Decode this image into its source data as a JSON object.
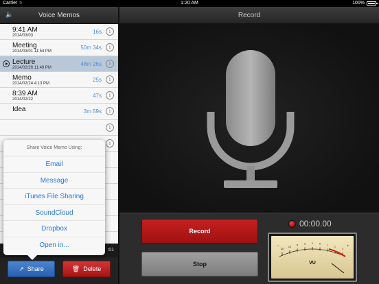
{
  "status": {
    "carrier": "Carrier",
    "time": "1:20 AM",
    "battery": "100%"
  },
  "left": {
    "title": "Voice Memos",
    "memos": [
      {
        "title": "9:41 AM",
        "date": "2014/03/03",
        "duration": "16s",
        "selected": false
      },
      {
        "title": "Meeting",
        "date": "2014/03/01 11:54 PM",
        "duration": "50m 34s",
        "selected": false
      },
      {
        "title": "Lecture",
        "date": "2014/02/26 11:49 PM",
        "duration": "48m 26s",
        "selected": true
      },
      {
        "title": "Memo",
        "date": "2014/02/24 4:13 PM",
        "duration": "25s",
        "selected": false
      },
      {
        "title": "8:39 AM",
        "date": "2014/02/22",
        "duration": "47s",
        "selected": false
      },
      {
        "title": "Idea",
        "date": "",
        "duration": "3m 59s",
        "selected": false
      }
    ],
    "elapsed": ":01",
    "share_label": "Share",
    "delete_label": "Delete"
  },
  "share_popover": {
    "title": "Share Voice Memo Using:",
    "items": [
      "Email",
      "Message",
      "iTunes File Sharing",
      "SoundCloud",
      "Dropbox",
      "Open in..."
    ]
  },
  "right": {
    "title": "Record",
    "record_label": "Record",
    "stop_label": "Stop",
    "timer": "00:00.00",
    "vu_label": "VU",
    "vu_ticks": [
      "20",
      "10",
      "5",
      "3",
      "1",
      "0",
      "1",
      "2",
      "3"
    ],
    "vu_minus": "−",
    "vu_plus": "+"
  },
  "colors": {
    "accent_blue": "#2a7ad6",
    "record_red": "#c61f1f",
    "selected_row": "#b9c8d8"
  }
}
